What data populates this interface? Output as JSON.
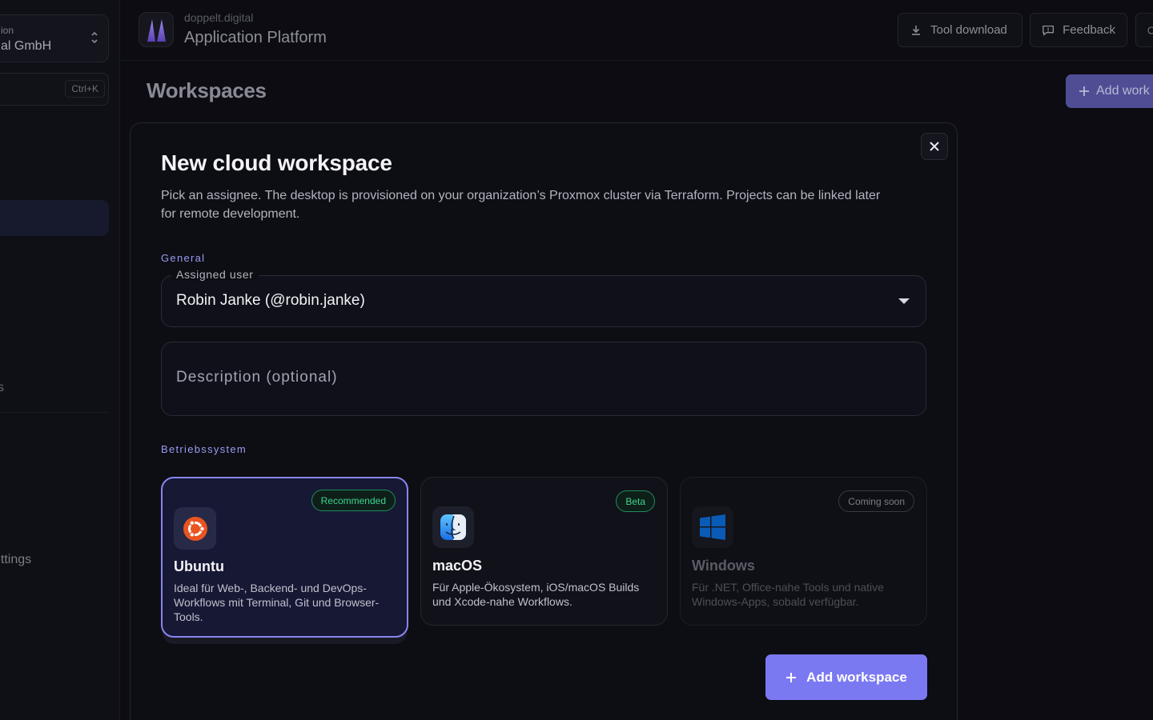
{
  "sidebar": {
    "org_label": "ion",
    "org_name": "al GmbH",
    "search_hint": "Ctrl+K",
    "nav_fragment": "s",
    "settings_label": "ettings"
  },
  "header": {
    "domain": "doppelt.digital",
    "title": "Application Platform",
    "tool_download": "Tool download",
    "feedback": "Feedback"
  },
  "page": {
    "title": "Workspaces",
    "add_button": "Add work"
  },
  "modal": {
    "title": "New cloud workspace",
    "description": "Pick an assignee. The desktop is provisioned on your organization’s Proxmox cluster via Terraform. Projects can be linked later for remote development.",
    "section_general": "General",
    "assigned_user_label": "Assigned user",
    "assigned_user_value": "Robin Janke (@robin.janke)",
    "description_placeholder": "Description (optional)",
    "section_os": "Betriebssystem",
    "os_options": [
      {
        "name": "Ubuntu",
        "badge": "Recommended",
        "description": "Ideal für Web-, Backend- und DevOps-Workflows mit Terminal, Git und Browser-Tools.",
        "icon": "ubuntu-icon"
      },
      {
        "name": "macOS",
        "badge": "Beta",
        "description": "Für Apple-Ökosystem, iOS/macOS Builds und Xcode-nahe Workflows.",
        "icon": "finder-icon"
      },
      {
        "name": "Windows",
        "badge": "Coming soon",
        "description": "Für .NET, Office-nahe Tools und native Windows-Apps, sobald verfügbar.",
        "icon": "windows-icon"
      }
    ],
    "submit_label": "Add workspace"
  },
  "colors": {
    "accent": "#7b79f2",
    "badge_green": "#3ed38e",
    "ubuntu_orange": "#e95420",
    "windows_blue": "#0a5bb5"
  }
}
